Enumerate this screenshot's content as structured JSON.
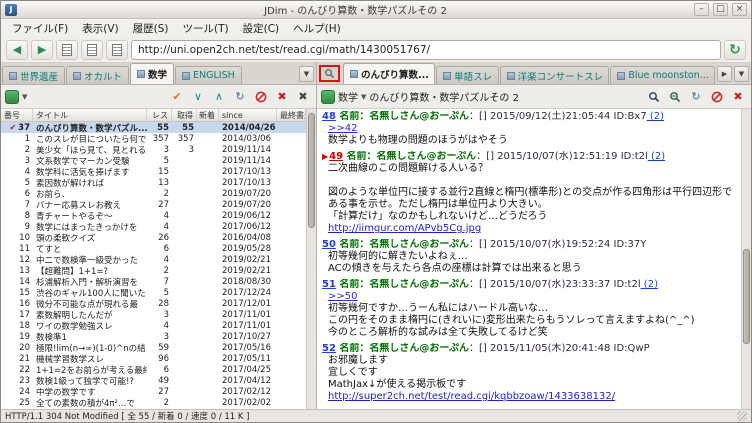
{
  "window": {
    "title": "JDim - のんびり算数・数学パズルその 2"
  },
  "menubar": {
    "items": [
      "ファイル(F)",
      "表示(V)",
      "履歴(S)",
      "ツール(T)",
      "設定(C)",
      "ヘルプ(H)"
    ]
  },
  "toolbar": {
    "url": "http://uni.open2ch.net/test/read.cgi/math/1430051767/"
  },
  "icons": {
    "back": "◀",
    "forward": "▶",
    "go": "↻",
    "check": "✔",
    "chev_down": "∨",
    "chev_up": "∧",
    "reload": "↻",
    "close": "✖",
    "dropdown": "▼",
    "tab_right": "▶",
    "marker": "▶",
    "minimize": "–",
    "maximize": "□",
    "close_win": "×"
  },
  "colors": {
    "accent_green": "#2f8a42",
    "tab_text": "#0a7c7c",
    "link_blue": "#1b3fd4",
    "name_green": "#007000",
    "marked_red": "#d00000",
    "highlight_border": "#e01010",
    "selected_row": "#c7d8ec"
  },
  "left_panel": {
    "tabs": [
      {
        "label": "世界遺産",
        "active": false
      },
      {
        "label": "オカルト",
        "active": false
      },
      {
        "label": "数学",
        "active": true
      },
      {
        "label": "ENGLISH",
        "active": false
      }
    ],
    "columns": [
      "番号",
      "タイトル",
      "レス",
      "取得",
      "新着",
      "since",
      "最終書込"
    ],
    "rows": [
      {
        "num": "37",
        "title": "のんびり算数・数学パズル...",
        "res": "55",
        "got": "55",
        "new": "",
        "since": "2014/04/26",
        "selected": true,
        "check": true
      },
      {
        "num": "1",
        "title": "このスレが目についたら何で",
        "res": "357",
        "got": "357",
        "new": "",
        "since": "2014/03/06"
      },
      {
        "num": "2",
        "title": "美少女「ほら見て、見とれる」",
        "res": "3",
        "got": "3",
        "new": "",
        "since": "2019/11/14"
      },
      {
        "num": "3",
        "title": "文系数学でマーカン受験",
        "res": "5",
        "got": "",
        "new": "",
        "since": "2019/11/14"
      },
      {
        "num": "4",
        "title": "数学科に活気を捧げます",
        "res": "15",
        "got": "",
        "new": "",
        "since": "2017/10/13"
      },
      {
        "num": "5",
        "title": "素因数が解ければ",
        "res": "13",
        "got": "",
        "new": "",
        "since": "2017/10/13"
      },
      {
        "num": "6",
        "title": "お前ら、",
        "res": "2",
        "got": "",
        "new": "",
        "since": "2019/07/20"
      },
      {
        "num": "7",
        "title": "バナー応募スレお教え",
        "res": "27",
        "got": "",
        "new": "",
        "since": "2019/07/20"
      },
      {
        "num": "8",
        "title": "青チャートやるぞ〜",
        "res": "4",
        "got": "",
        "new": "",
        "since": "2019/06/12"
      },
      {
        "num": "9",
        "title": "数学にはまったきっかけを",
        "res": "4",
        "got": "",
        "new": "",
        "since": "2017/06/12"
      },
      {
        "num": "10",
        "title": "頭の柔軟クイズ",
        "res": "26",
        "got": "",
        "new": "",
        "since": "2016/04/08"
      },
      {
        "num": "11",
        "title": "てすと",
        "res": "6",
        "got": "",
        "new": "",
        "since": "2019/05/28"
      },
      {
        "num": "12",
        "title": "中二で数検準一級受かった",
        "res": "4",
        "got": "",
        "new": "",
        "since": "2019/02/21"
      },
      {
        "num": "13",
        "title": "【超難問】1+1=?",
        "res": "2",
        "got": "",
        "new": "",
        "since": "2019/02/21"
      },
      {
        "num": "14",
        "title": "杉浦解析入門・解析演習を",
        "res": "7",
        "got": "",
        "new": "",
        "since": "2018/08/30"
      },
      {
        "num": "15",
        "title": "渋谷のギャル100人に聞いた",
        "res": "5",
        "got": "",
        "new": "",
        "since": "2017/12/24"
      },
      {
        "num": "16",
        "title": "微分不可能な点が現れる最",
        "res": "28",
        "got": "",
        "new": "",
        "since": "2017/12/01"
      },
      {
        "num": "17",
        "title": "素数解明したんだが",
        "res": "3",
        "got": "",
        "new": "",
        "since": "2017/11/01"
      },
      {
        "num": "18",
        "title": "ワイの数学勉強スレ",
        "res": "4",
        "got": "",
        "new": "",
        "since": "2017/11/01"
      },
      {
        "num": "19",
        "title": "数検準1",
        "res": "3",
        "got": "",
        "new": "",
        "since": "2017/10/27"
      },
      {
        "num": "20",
        "title": "極限!lim(n→∞)(1-0)^nの結",
        "res": "59",
        "got": "",
        "new": "",
        "since": "2017/05/16"
      },
      {
        "num": "21",
        "title": "機械学習数学スレ",
        "res": "96",
        "got": "",
        "new": "",
        "since": "2017/05/11"
      },
      {
        "num": "22",
        "title": "1+1=2をお前らが考える最終",
        "res": "6",
        "got": "",
        "new": "",
        "since": "2017/04/25"
      },
      {
        "num": "23",
        "title": "数検1級って独学で可能!?",
        "res": "49",
        "got": "",
        "new": "",
        "since": "2017/04/12"
      },
      {
        "num": "24",
        "title": "中学の数学です",
        "res": "27",
        "got": "",
        "new": "",
        "since": "2017/02/12"
      },
      {
        "num": "25",
        "title": "全ての素数の積が4π²…で",
        "res": "2",
        "got": "",
        "new": "",
        "since": "2017/02/02"
      }
    ]
  },
  "right_panel": {
    "tabs": [
      {
        "label": "のんびり算数...",
        "active": true
      },
      {
        "label": "単語スレ",
        "active": false
      },
      {
        "label": "洋楽コンサートスレ",
        "active": false
      },
      {
        "label": "Blue moonston...",
        "active": false
      }
    ],
    "board_label": "数学",
    "thread_title": "のんびり算数・数学パズルその 2",
    "posts": [
      {
        "num": "48",
        "name_label": "名前：",
        "name": "名無しさん@おーぷん",
        "mail": "：[]",
        "date": "2015/09/12(土)21:05:44",
        "id": "ID:Bx7",
        "count": "(2)",
        "lines": [
          ">>42",
          "数学よりも物理の問題のほうがはやそう"
        ]
      },
      {
        "num": "49",
        "marked": true,
        "name_label": "名前：",
        "name": "名無しさん@おーぷん",
        "mail": "：[]",
        "date": "2015/10/07(水)12:51:19",
        "id": "ID:t2l",
        "count": "(2)",
        "lines": [
          "二次曲線のこの問題解ける人いる？",
          "",
          "図のような単位円に接する並行2直線と楕円(標準形)との交点が作る四角形は平行四辺形である事を示せ。ただし楕円は単位円より大きい。",
          "「計算だけ」なのかもしれないけど…どうだろう",
          "http://iimgur.com/APvb5Cg.jpg"
        ]
      },
      {
        "num": "50",
        "name_label": "名前：",
        "name": "名無しさん@おーぷん",
        "mail": "：[]",
        "date": "2015/10/07(水)19:52:24",
        "id": "ID:37Y",
        "count": "",
        "lines": [
          "初等幾何的に解きたいよねぇ…",
          "ACの傾きを与えたら各点の座標は計算では出来ると思う"
        ]
      },
      {
        "num": "51",
        "name_label": "名前：",
        "name": "名無しさん@おーぷん",
        "mail": "：[]",
        "date": "2015/10/07(水)23:33:37",
        "id": "ID:t2l",
        "count": "(2)",
        "lines": [
          ">>50",
          "初等幾何ですか…うーん私にはハードル高いな…",
          "この円をそのまま楕円に(きれいに)変形出来たらもうソレって言えますよね(^_^)",
          "今のところ解析的な試みは全て失敗してるけど笑"
        ]
      },
      {
        "num": "52",
        "name_label": "名前：",
        "name": "名無しさん@おーぷん",
        "mail": "：[]",
        "date": "2015/11/05(木)20:41:48",
        "id": "ID:QwP",
        "count": "",
        "lines": [
          "お邪魔します",
          "宜しくです",
          "MathJax↓が使える掲示板です",
          "http://super2ch.net/test/read.cgi/kqbbzoaw/1433638132/"
        ]
      }
    ]
  },
  "statusbar": {
    "text": "HTTP/1.1 304 Not Modified [ 全 55 / 新着 0 / 速度 0 / 11 K ]"
  }
}
